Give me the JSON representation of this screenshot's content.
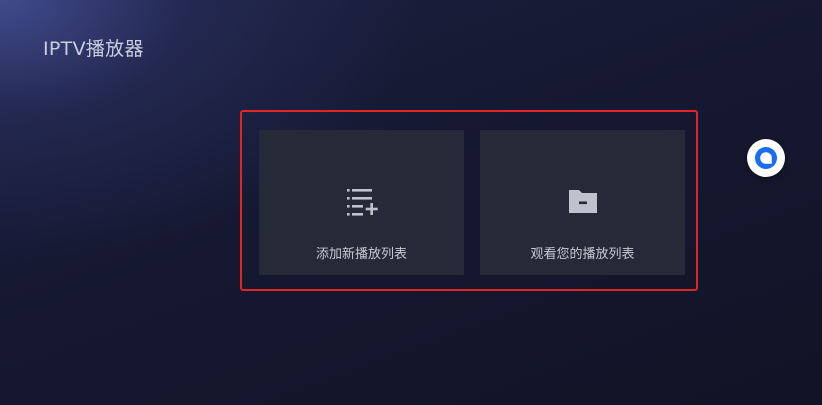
{
  "app": {
    "title": "IPTV播放器"
  },
  "actions": {
    "add_playlist": {
      "label": "添加新播放列表",
      "icon": "playlist-add-icon"
    },
    "view_playlists": {
      "label": "观看您的播放列表",
      "icon": "folder-icon"
    }
  },
  "floating_button": {
    "icon": "chat-bubble-icon",
    "accent_color": "#1a6cf0"
  },
  "colors": {
    "selection_frame": "#e02525",
    "card_background": "#262938",
    "text": "#c8cad2"
  }
}
